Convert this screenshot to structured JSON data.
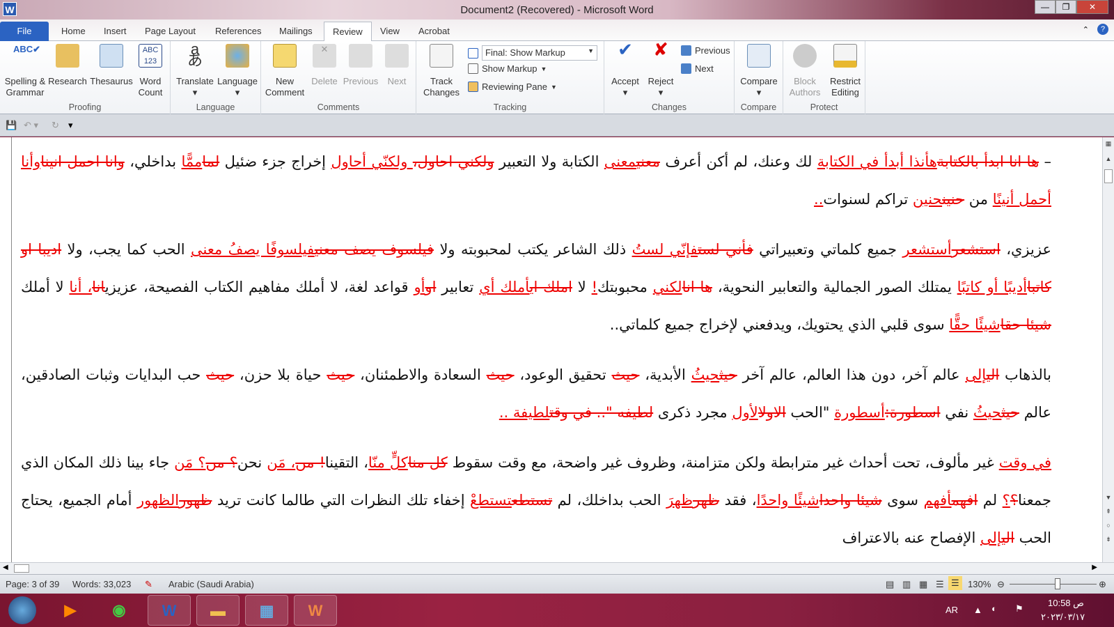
{
  "window": {
    "title": "Document2 (Recovered)  -  Microsoft Word",
    "app_icon": "W",
    "minimize": "—",
    "restore": "❐",
    "close": "✕"
  },
  "tabs": [
    "File",
    "Home",
    "Insert",
    "Page Layout",
    "References",
    "Mailings",
    "Review",
    "View",
    "Acrobat"
  ],
  "ribbon": {
    "proofing": {
      "label": "Proofing",
      "spelling": [
        "Spelling &",
        "Grammar"
      ],
      "research": "Research",
      "thesaurus": "Thesaurus",
      "word_count": [
        "Word",
        "Count"
      ]
    },
    "language": {
      "label": "Language",
      "translate": "Translate",
      "language": "Language"
    },
    "comments": {
      "label": "Comments",
      "new": [
        "New",
        "Comment"
      ],
      "delete": "Delete",
      "previous": "Previous",
      "next": "Next"
    },
    "tracking": {
      "label": "Tracking",
      "track": [
        "Track",
        "Changes"
      ],
      "display_select": "Final: Show Markup",
      "show_markup": "Show Markup",
      "reviewing_pane": "Reviewing Pane"
    },
    "changes": {
      "label": "Changes",
      "accept": "Accept",
      "reject": "Reject",
      "previous": "Previous",
      "next": "Next"
    },
    "compare": {
      "label": "Compare",
      "compare": "Compare"
    },
    "protect": {
      "label": "Protect",
      "block": [
        "Block",
        "Authors"
      ],
      "restrict": [
        "Restrict",
        "Editing"
      ]
    }
  },
  "colors": {
    "accent": "#2b63c2",
    "revision": "#e00000"
  },
  "document": {
    "paragraphs": [
      [
        [
          "n",
          "– "
        ],
        [
          "d",
          "ها انا ابدأ بالكتابة"
        ],
        [
          "i",
          "هأنذا أبدأ في الكتابة"
        ],
        [
          "n",
          " لك وعنك، لم أكن أعرف "
        ],
        [
          "d",
          "معني"
        ],
        [
          "i",
          "معنى"
        ],
        [
          "n",
          " الكتابة ولا التعبير "
        ],
        [
          "d",
          "ولكني احاول،"
        ],
        [
          "i",
          " ولكنّي أحاول"
        ],
        [
          "n",
          " إخراج جزء ضئيل "
        ],
        [
          "d",
          "لما"
        ],
        [
          "i",
          "ممًّا"
        ],
        [
          "n",
          " بداخلي، "
        ],
        [
          "d",
          "وانا احمل انينا"
        ],
        [
          "i",
          "وأنا أحمل أنينًا"
        ],
        [
          "n",
          " من "
        ],
        [
          "d",
          "حنين"
        ],
        [
          "i",
          "حنين"
        ],
        [
          "n",
          " تراكم لسنوات"
        ],
        [
          "i",
          ".."
        ]
      ],
      [
        [
          "n",
          "عزيزي، "
        ],
        [
          "d",
          "استشعر"
        ],
        [
          "i",
          "أستشعر"
        ],
        [
          "n",
          " جميع كلماتي وتعبيراتي "
        ],
        [
          "d",
          "فأني لست"
        ],
        [
          "i",
          "فإنّي لستُ"
        ],
        [
          "n",
          " ذلك الشاعر يكتب لمحبوبته ولا "
        ],
        [
          "d",
          "فيلسوف يصف معني"
        ],
        [
          "i",
          "فيلسوفًا يصفُ معنى"
        ],
        [
          "n",
          " الحب كما يجب، ولا "
        ],
        [
          "d",
          "اديبا او كاتبا"
        ],
        [
          "i",
          "أديبًا أو كاتبًا"
        ],
        [
          "n",
          " يمتلك الصور الجمالية والتعابير النحوية، "
        ],
        [
          "d",
          "ها انا"
        ],
        [
          "i",
          "لكني"
        ],
        [
          "n",
          " محبوبتك"
        ],
        [
          "i",
          "!"
        ],
        [
          "n",
          " لا "
        ],
        [
          "d",
          "املك اي"
        ],
        [
          "i",
          "أملك أي"
        ],
        [
          "n",
          " تعابير "
        ],
        [
          "d",
          "او"
        ],
        [
          "i",
          "أو"
        ],
        [
          "n",
          " قواعد لغة، لا أملك مفاهيم الكتاب الفصيحة، عزيزي"
        ],
        [
          "d",
          "انا"
        ],
        [
          "i",
          "، أنا"
        ],
        [
          "n",
          " لا أملك "
        ],
        [
          "d",
          "شيئا حقا"
        ],
        [
          "i",
          "شيئًا حقًّا"
        ],
        [
          "n",
          " سوى قلبي الذي يحتويك، ويدفعني لإخراج جميع كلماتي.."
        ]
      ],
      [
        [
          "n",
          "بالذهاب "
        ],
        [
          "d",
          "الي"
        ],
        [
          "i",
          "إلى"
        ],
        [
          "n",
          " عالم آخر، دون هذا العالم، عالم آخر "
        ],
        [
          "d",
          "حيث"
        ],
        [
          "i",
          "حيثُ"
        ],
        [
          "n",
          " الأبدية، "
        ],
        [
          "d",
          "حيث"
        ],
        [
          "n",
          " تحقيق الوعود، "
        ],
        [
          "d",
          "حيث"
        ],
        [
          "n",
          " السعادة والاطمئنان، "
        ],
        [
          "d",
          "حيث"
        ],
        [
          "n",
          " حياة بلا حزن، "
        ],
        [
          "d",
          "حيث"
        ],
        [
          "n",
          " حب البدايات وثبات الصادقين، عالم "
        ],
        [
          "d",
          "حيث"
        ],
        [
          "i",
          "حيثُ"
        ],
        [
          "n",
          " نفي "
        ],
        [
          "d",
          "اسطورة:"
        ],
        [
          "i",
          "أسطورة"
        ],
        [
          "n",
          " \"الحب "
        ],
        [
          "d",
          "الاول"
        ],
        [
          "i",
          "الأول"
        ],
        [
          "n",
          " مجرد ذكرى "
        ],
        [
          "d",
          "لطيفه \".. في وقت"
        ],
        [
          "i",
          "لطيفة .."
        ]
      ],
      [
        [
          "i",
          "في وقت"
        ],
        [
          "n",
          " غير مألوف، تحت أحداث غير مترابطة ولكن متزامنة، وظروف غير واضحة، مع وقت سقوط "
        ],
        [
          "d",
          "كل منا"
        ],
        [
          "i",
          "كلٍّ منّا"
        ],
        [
          "n",
          "، التقينا"
        ],
        [
          "d",
          "! من"
        ],
        [
          "i",
          "، مَن"
        ],
        [
          "n",
          " نحن"
        ],
        [
          "d",
          "؟ من"
        ],
        [
          "i",
          "؟ مَن"
        ],
        [
          "n",
          " جاء بينا ذلك المكان الذي جمعنا"
        ],
        [
          "d",
          "؟"
        ],
        [
          "i",
          "؟"
        ],
        [
          "n",
          " لم "
        ],
        [
          "d",
          "افهم"
        ],
        [
          "i",
          "أفهم"
        ],
        [
          "n",
          " سوى "
        ],
        [
          "d",
          "شيئا واحدا"
        ],
        [
          "i",
          "شيئًا واحدًا"
        ],
        [
          "n",
          "، فقد "
        ],
        [
          "d",
          "ظهر"
        ],
        [
          "i",
          "ظهرَ"
        ],
        [
          "n",
          " الحب بداخلك، لم "
        ],
        [
          "d",
          "تستطع"
        ],
        [
          "i",
          "تستطعْ"
        ],
        [
          "n",
          " إخفاء تلك النظرات التي طالما كانت تريد "
        ],
        [
          "d",
          "ظهور"
        ],
        [
          "i",
          "الظهور"
        ],
        [
          "n",
          " أمام الجميع، يحتاج الحب "
        ],
        [
          "d",
          "الي"
        ],
        [
          "i",
          "إلى"
        ],
        [
          "n",
          " الإفصاح عنه بالاعتراف"
        ]
      ]
    ]
  },
  "status": {
    "page": "Page: 3 of 39",
    "words": "Words: 33,023",
    "language": "Arabic (Saudi Arabia)",
    "zoom": "130%",
    "zoom_level_percent": 130
  },
  "taskbar": {
    "lang": "AR",
    "time": "10:58 ص",
    "date": "٢٠٢٣/٠٣/١٧"
  }
}
